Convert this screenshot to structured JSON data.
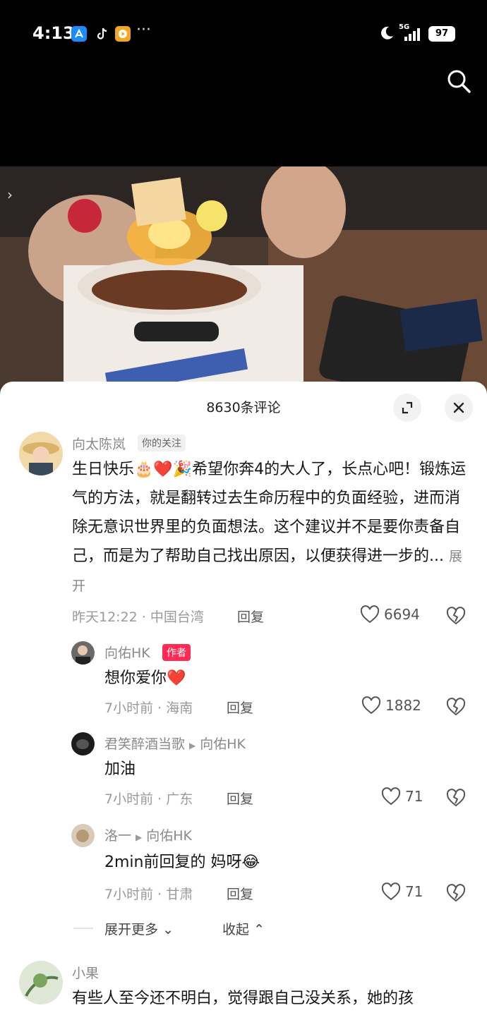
{
  "status": {
    "time": "4:13",
    "network": "5G",
    "battery": "97",
    "more": "···"
  },
  "comments_panel": {
    "title": "8630条评论",
    "expand_label": "展开",
    "reply_label": "回复"
  },
  "top_comment": {
    "username": "向太陈岚",
    "follow_tag": "你的关注",
    "text": "生日快乐🎂❤️🎉希望你奔4的大人了，长点心吧！锻炼运气的方法，就是翻转过去生命历程中的负面经验，进而消除无意识世界里的负面想法。这个建议并不是要你责备自己，而是为了帮助自己找出原因，以便获得进一步的...",
    "time_location": "昨天12:22 · 中国台湾",
    "likes": "6694"
  },
  "replies": [
    {
      "username": "向佑HK",
      "author_tag": "作者",
      "text": "想你爱你❤️",
      "time_location": "7小时前 · 海南",
      "likes": "1882"
    },
    {
      "username": "君笑醉酒当歌",
      "reply_to": "向佑HK",
      "text": "加油",
      "time_location": "7小时前 · 广东",
      "likes": "71"
    },
    {
      "username": "洛一",
      "reply_to": "向佑HK",
      "text": "2min前回复的  妈呀😂",
      "time_location": "7小时前 · 甘肃",
      "likes": "71"
    }
  ],
  "thread_controls": {
    "expand_more": "展开更多",
    "collapse": "收起"
  },
  "next_comment": {
    "username": "小果",
    "text": "有些人至今还不明白，觉得跟自己没关系，她的孩"
  },
  "colors": {
    "author_tag": "#fe2c55",
    "panel_bg": "#ffffff"
  }
}
